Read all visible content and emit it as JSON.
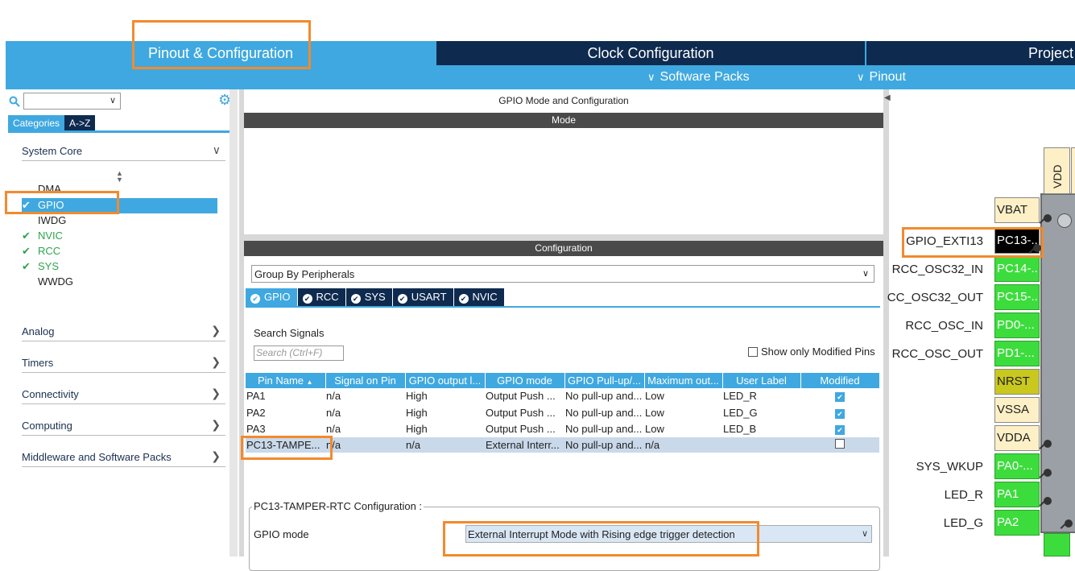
{
  "top_tabs": {
    "pinout": "Pinout & Configuration",
    "clock": "Clock Configuration",
    "project": "Project"
  },
  "sub_menu": {
    "software_packs": "Software Packs",
    "pinout": "Pinout"
  },
  "left": {
    "search_value": "",
    "tab_categories": "Categories",
    "tab_az": "A->Z",
    "system_core": "System Core",
    "items": [
      {
        "label": "DMA",
        "checked": false
      },
      {
        "label": "GPIO",
        "checked": true,
        "selected": true
      },
      {
        "label": "IWDG",
        "checked": false
      },
      {
        "label": "NVIC",
        "checked": true
      },
      {
        "label": "RCC",
        "checked": true
      },
      {
        "label": "SYS",
        "checked": true
      },
      {
        "label": "WWDG",
        "checked": false
      }
    ],
    "sections": [
      "Analog",
      "Timers",
      "Connectivity",
      "Computing",
      "Middleware and Software Packs"
    ]
  },
  "middle": {
    "title": "GPIO Mode and Configuration",
    "mode_header": "Mode",
    "config_header": "Configuration",
    "group_by": "Group By Peripherals",
    "periph_tabs": [
      "GPIO",
      "RCC",
      "SYS",
      "USART",
      "NVIC"
    ],
    "search_label": "Search Signals",
    "search_placeholder": "Search (Ctrl+F)",
    "show_modified": "Show only Modified Pins",
    "columns": [
      "Pin Name",
      "Signal on Pin",
      "GPIO output l...",
      "GPIO mode",
      "GPIO Pull-up/...",
      "Maximum out...",
      "User Label",
      "Modified"
    ],
    "rows": [
      [
        "PA1",
        "n/a",
        "High",
        "Output Push ...",
        "No pull-up and...",
        "Low",
        "LED_R",
        true
      ],
      [
        "PA2",
        "n/a",
        "High",
        "Output Push ...",
        "No pull-up and...",
        "Low",
        "LED_G",
        true
      ],
      [
        "PA3",
        "n/a",
        "High",
        "Output Push ...",
        "No pull-up and...",
        "Low",
        "LED_B",
        true
      ],
      [
        "PC13-TAMPE...",
        "n/a",
        "n/a",
        "External Interr...",
        "No pull-up and...",
        "n/a",
        "",
        false
      ]
    ],
    "pin_config_title": "PC13-TAMPER-RTC Configuration :",
    "gpio_mode_label": "GPIO mode",
    "gpio_mode_value": "External Interrupt Mode with Rising edge trigger detection"
  },
  "right": {
    "top_pin": "VDD",
    "pins": [
      {
        "pin": "VBAT",
        "label": "",
        "color": "tan"
      },
      {
        "pin": "PC13-...",
        "label": "GPIO_EXTI13",
        "color": "black"
      },
      {
        "pin": "PC14-...",
        "label": "RCC_OSC32_IN",
        "color": "green"
      },
      {
        "pin": "PC15-...",
        "label": "CC_OSC32_OUT",
        "color": "green"
      },
      {
        "pin": "PD0-...",
        "label": "RCC_OSC_IN",
        "color": "green"
      },
      {
        "pin": "PD1-...",
        "label": "RCC_OSC_OUT",
        "color": "green"
      },
      {
        "pin": "NRST",
        "label": "",
        "color": "olive"
      },
      {
        "pin": "VSSA",
        "label": "",
        "color": "tan"
      },
      {
        "pin": "VDDA",
        "label": "",
        "color": "tan"
      },
      {
        "pin": "PA0-...",
        "label": "SYS_WKUP",
        "color": "green"
      },
      {
        "pin": "PA1",
        "label": "LED_R",
        "color": "green"
      },
      {
        "pin": "PA2",
        "label": "LED_G",
        "color": "green"
      }
    ]
  },
  "colors": {
    "accent": "#3fa8e0",
    "navy": "#0e2a4f",
    "highlight": "#f28a2e",
    "pin_green": "#3ddc3d"
  }
}
